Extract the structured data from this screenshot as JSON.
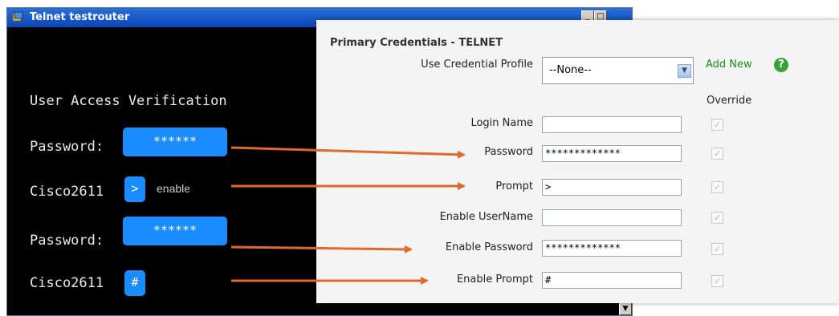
{
  "telnet": {
    "title": "Telnet testrouter",
    "minimize": "_",
    "maximize": "□",
    "scroll_down": "▼",
    "heading": "User Access Verification",
    "lines": [
      {
        "prefix": "Password:",
        "box": "******"
      },
      {
        "prefix": "Cisco2611",
        "box": ">",
        "extra": "enable"
      },
      {
        "prefix": "Password:",
        "box": "******"
      },
      {
        "prefix": "Cisco2611",
        "box": "#"
      }
    ]
  },
  "credentials": {
    "title": "Primary Credentials - TELNET",
    "profile_label": "Use Credential Profile",
    "profile_value": "--None--",
    "add_new": "Add New",
    "help": "?",
    "override_label": "Override",
    "rows": [
      {
        "label": "Login Name",
        "value": ""
      },
      {
        "label": "Password",
        "value": "*************"
      },
      {
        "label": "Prompt",
        "value": ">"
      },
      {
        "label": "Enable UserName",
        "value": ""
      },
      {
        "label": "Enable Password",
        "value": "*************"
      },
      {
        "label": "Enable Prompt",
        "value": "#"
      }
    ],
    "checkmark": "✓"
  },
  "colors": {
    "arrow": "#e06a28",
    "highlight": "#1a8cff",
    "terminal_bg": "#000000"
  }
}
